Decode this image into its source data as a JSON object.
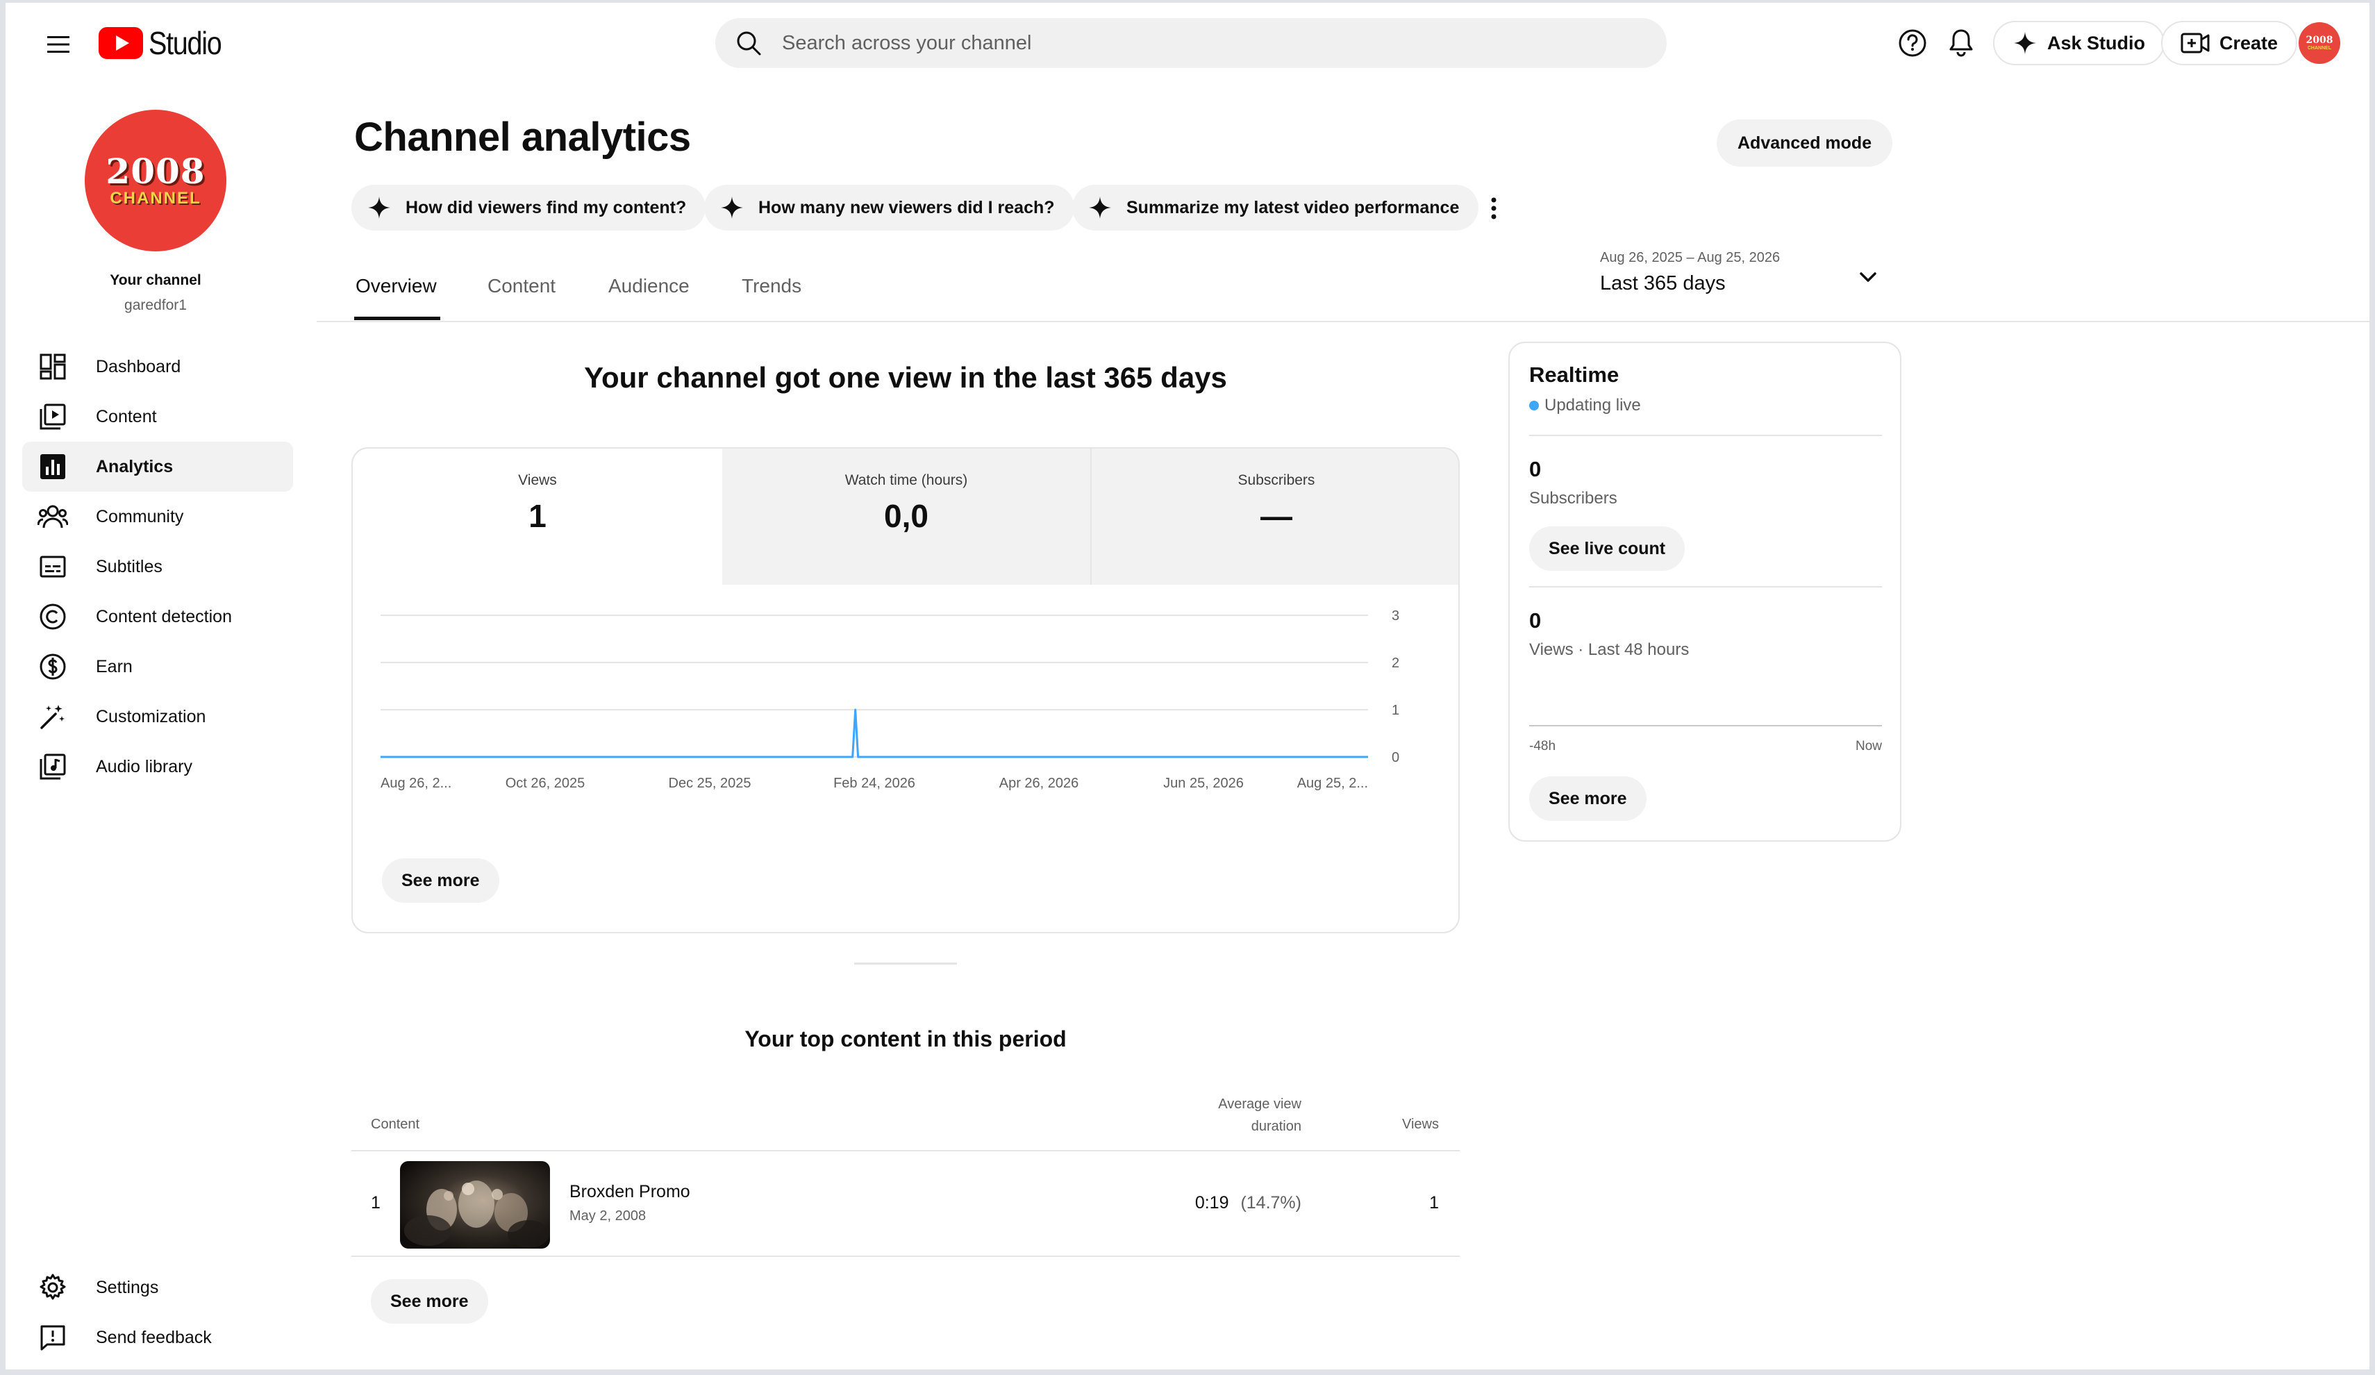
{
  "header": {
    "logo_text": "Studio",
    "search_placeholder": "Search across your channel",
    "ask_studio": "Ask Studio",
    "create": "Create",
    "avatar_line1": "2008",
    "avatar_line2": "CHANNEL"
  },
  "sidebar": {
    "avatar_line1": "2008",
    "avatar_line2": "CHANNEL",
    "your_channel": "Your channel",
    "handle": "garedfor1",
    "items": [
      {
        "label": "Dashboard",
        "icon": "dashboard-icon"
      },
      {
        "label": "Content",
        "icon": "content-icon"
      },
      {
        "label": "Analytics",
        "icon": "analytics-icon",
        "active": true
      },
      {
        "label": "Community",
        "icon": "community-icon"
      },
      {
        "label": "Subtitles",
        "icon": "subtitles-icon"
      },
      {
        "label": "Content detection",
        "icon": "copyright-icon"
      },
      {
        "label": "Earn",
        "icon": "dollar-icon"
      },
      {
        "label": "Customization",
        "icon": "magic-wand-icon"
      },
      {
        "label": "Audio library",
        "icon": "audio-library-icon"
      }
    ],
    "bottom": [
      {
        "label": "Settings",
        "icon": "gear-icon"
      },
      {
        "label": "Send feedback",
        "icon": "feedback-icon"
      }
    ]
  },
  "main": {
    "title": "Channel analytics",
    "advanced_mode": "Advanced mode",
    "chips": [
      "How did viewers find my content?",
      "How many new viewers did I reach?",
      "Summarize my latest video performance"
    ],
    "tabs": [
      "Overview",
      "Content",
      "Audience",
      "Trends"
    ],
    "active_tab": "Overview",
    "date_range": "Aug 26, 2025 – Aug 25, 2026",
    "date_label": "Last 365 days"
  },
  "overview": {
    "headline": "Your channel got one view in the last 365 days",
    "metrics": [
      {
        "label": "Views",
        "value": "1"
      },
      {
        "label": "Watch time (hours)",
        "value": "0,0"
      },
      {
        "label": "Subscribers",
        "value": "—"
      }
    ],
    "see_more": "See more"
  },
  "chart_data": {
    "type": "line",
    "x_tick_labels": [
      "Aug 26, 2...",
      "Oct 26, 2025",
      "Dec 25, 2025",
      "Feb 24, 2026",
      "Apr 26, 2026",
      "Jun 25, 2026",
      "Aug 25, 2..."
    ],
    "y_ticks": [
      0,
      1,
      2,
      3
    ],
    "ylim": [
      0,
      3
    ],
    "x_range": [
      "2025-08-26",
      "2026-08-25"
    ],
    "series": [
      {
        "points": [
          [
            "2025-08-26",
            0
          ],
          [
            "2026-02-16",
            0
          ],
          [
            "2026-02-17",
            1
          ],
          [
            "2026-02-18",
            0
          ],
          [
            "2026-08-25",
            0
          ]
        ]
      }
    ],
    "grid": true,
    "color": "#3ea6ff"
  },
  "top_content": {
    "title": "Your top content in this period",
    "col_content": "Content",
    "col_avd_line1": "Average view",
    "col_avd_line2": "duration",
    "col_views": "Views",
    "rows": [
      {
        "rank": "1",
        "title": "Broxden Promo",
        "date": "May 2, 2008",
        "avd": "0:19",
        "avd_pct": "(14.7%)",
        "views": "1"
      }
    ],
    "see_more": "See more"
  },
  "realtime": {
    "title": "Realtime",
    "status": "Updating live",
    "subs_value": "0",
    "subs_label": "Subscribers",
    "see_live_count": "See live count",
    "views_value": "0",
    "views_label": "Views · Last 48 hours",
    "axis_start": "-48h",
    "axis_end": "Now",
    "see_more": "See more"
  }
}
